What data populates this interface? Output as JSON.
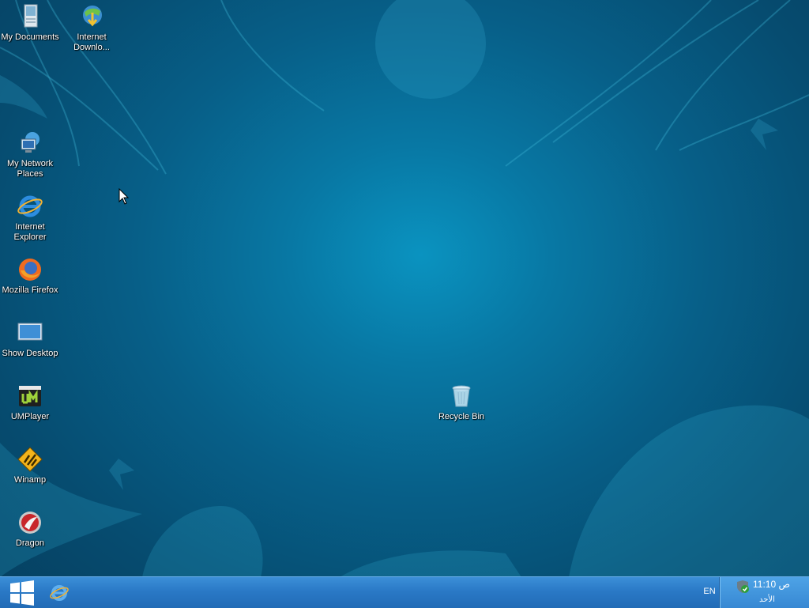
{
  "desktop": {
    "icons": [
      {
        "label": "My Documents",
        "icon": "my-documents-icon"
      },
      {
        "label": "Internet Downlo...",
        "icon": "internet-download-manager-icon"
      },
      {
        "label": "My Network Places",
        "icon": "network-places-icon"
      },
      {
        "label": "Internet Explorer",
        "icon": "internet-explorer-icon"
      },
      {
        "label": "Mozilla Firefox",
        "icon": "firefox-icon"
      },
      {
        "label": "Show Desktop",
        "icon": "show-desktop-icon"
      },
      {
        "label": "UMPlayer",
        "icon": "umplayer-icon"
      },
      {
        "label": "Winamp",
        "icon": "winamp-icon"
      },
      {
        "label": "Dragon",
        "icon": "dragon-browser-icon"
      },
      {
        "label": "Recycle Bin",
        "icon": "recycle-bin-icon"
      }
    ]
  },
  "taskbar": {
    "start_icon": "windows-logo-icon",
    "quick_launch_icon": "internet-explorer-icon",
    "language": "EN",
    "clock": {
      "time": "11:10 ص",
      "day": "الأحد"
    },
    "tray_icon": "security-shield-icon"
  },
  "colors": {
    "desktop_bg": "#0878a4",
    "taskbar": "#2a79c6",
    "tray": "#3f93db"
  }
}
